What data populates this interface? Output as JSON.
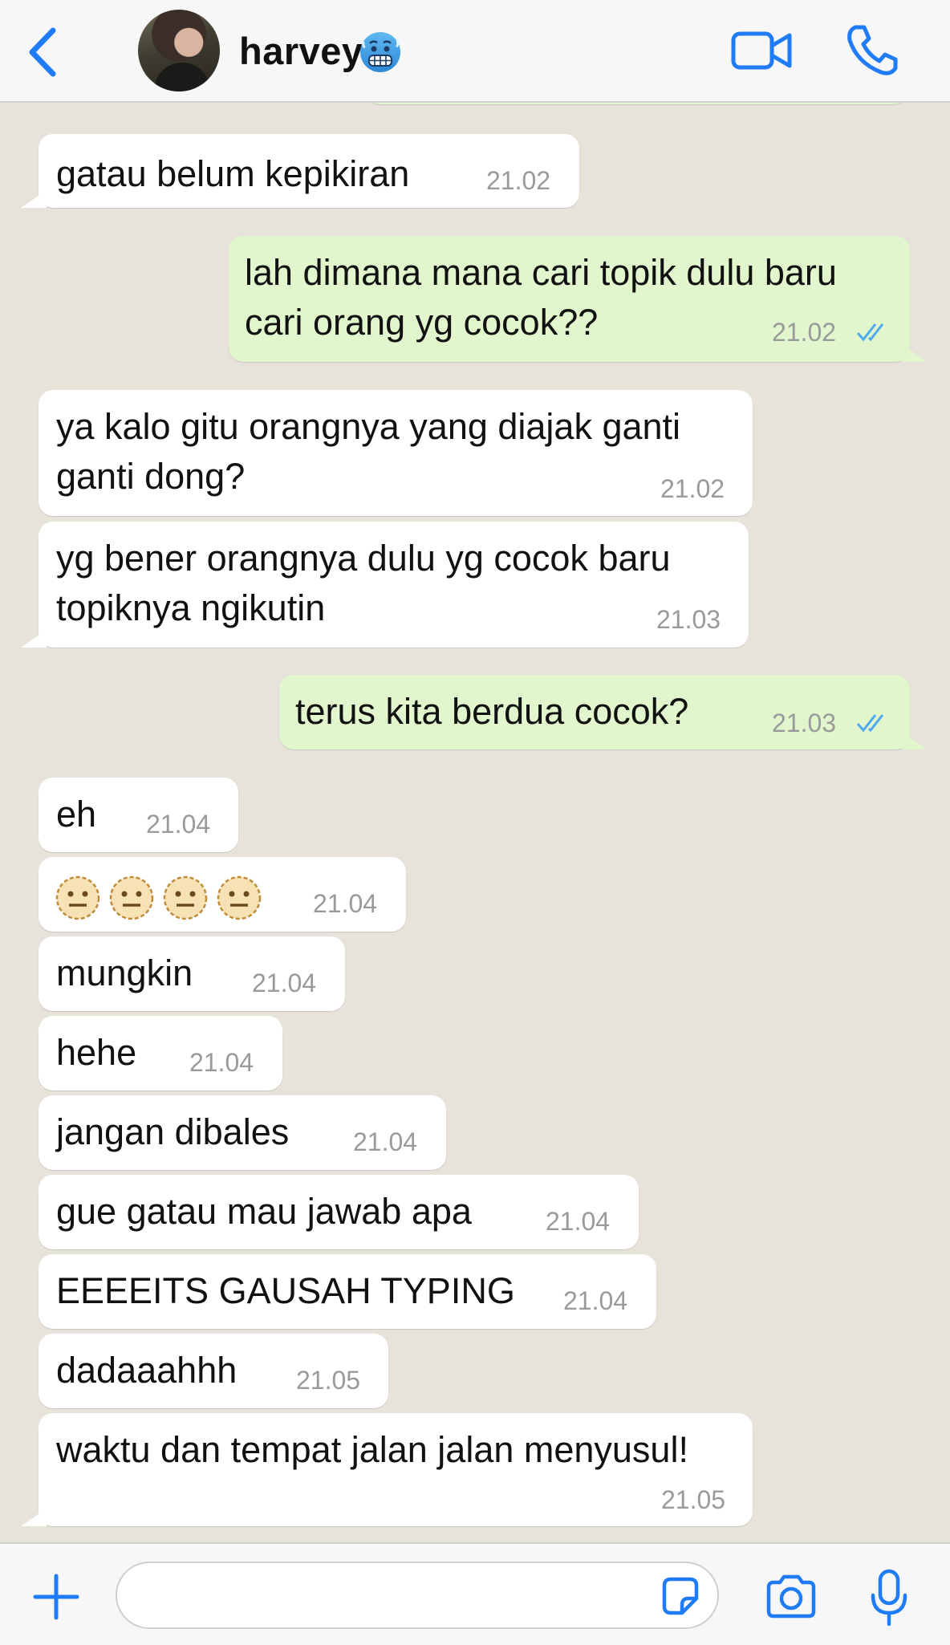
{
  "header": {
    "contact_name": "harvey",
    "contact_emoji": "cold-face-emoji",
    "back_icon": "chevron-left-icon",
    "video_icon": "video-camera-icon",
    "call_icon": "phone-icon",
    "accent_color": "#1f7bf6"
  },
  "messages": [
    {
      "dir": "in",
      "text": "gatau belum kepikiran",
      "time": "21.02"
    },
    {
      "dir": "out",
      "lines": [
        "lah dimana mana cari topik dulu baru",
        "cari orang yg cocok??"
      ],
      "time": "21.02",
      "status": "read"
    },
    {
      "dir": "in",
      "lines": [
        "ya kalo gitu orangnya yang diajak ganti",
        "ganti dong?"
      ],
      "time": "21.02"
    },
    {
      "dir": "in",
      "lines": [
        "yg bener orangnya dulu yg cocok baru",
        "topiknya ngikutin"
      ],
      "time": "21.03"
    },
    {
      "dir": "out",
      "text": "terus kita berdua cocok?",
      "time": "21.03",
      "status": "read"
    },
    {
      "dir": "in",
      "text": "eh",
      "time": "21.04"
    },
    {
      "dir": "in",
      "emoji": "neutral-face-emoji x4",
      "time": "21.04"
    },
    {
      "dir": "in",
      "text": "mungkin",
      "time": "21.04"
    },
    {
      "dir": "in",
      "text": "hehe",
      "time": "21.04"
    },
    {
      "dir": "in",
      "text": "jangan dibales",
      "time": "21.04"
    },
    {
      "dir": "in",
      "text": "gue gatau mau jawab apa",
      "time": "21.04"
    },
    {
      "dir": "in",
      "text": "EEEEITS GAUSAH TYPING",
      "time": "21.04"
    },
    {
      "dir": "in",
      "text": "dadaaahhh",
      "time": "21.05"
    },
    {
      "dir": "in",
      "text": "waktu dan tempat jalan jalan menyusul!",
      "time": "21.05"
    }
  ],
  "input_bar": {
    "plus_icon": "plus-icon",
    "message_placeholder": "",
    "sticker_icon": "sticker-icon",
    "camera_icon": "camera-icon",
    "mic_icon": "microphone-icon"
  },
  "colors": {
    "chat_background": "#e7e2da",
    "incoming_bubble": "#ffffff",
    "outgoing_bubble": "#e1f6cc",
    "read_tick": "#4fa9f0"
  }
}
